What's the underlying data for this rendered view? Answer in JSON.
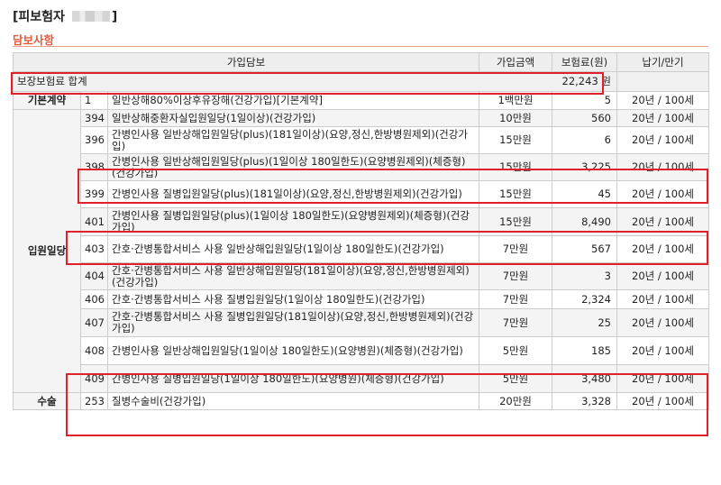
{
  "header": {
    "insured_label": "[피보험자",
    "insured_close": "]"
  },
  "section": {
    "title": "담보사항"
  },
  "columns": {
    "coverage": "가입담보",
    "amount": "가입금액",
    "premium": "보험료(원)",
    "term": "납기/만기"
  },
  "total": {
    "label": "보장보험료 합계",
    "value": "22,243 원"
  },
  "categories": {
    "basic": "기본계약",
    "hospital": "입원일당",
    "surgery": "수술"
  },
  "rows": [
    {
      "no": "1",
      "name": "일반상해80%이상후유장해(건강가입)[기본계약]",
      "amount": "1백만원",
      "premium": "5",
      "term": "20년 / 100세"
    },
    {
      "no": "394",
      "name": "일반상해중환자실입원일당(1일이상)(건강가입)",
      "amount": "10만원",
      "premium": "560",
      "term": "20년 / 100세"
    },
    {
      "no": "396",
      "name": "간병인사용 일반상해입원일당(plus)(181일이상)(요양,정신,한방병원제외)(건강가입)",
      "amount": "15만원",
      "premium": "6",
      "term": "20년 / 100세"
    },
    {
      "no": "398",
      "name": "간병인사용 일반상해입원일당(plus)(1일이상 180일한도)(요양병원제외)(체증형)(건강가입)",
      "amount": "15만원",
      "premium": "3,225",
      "term": "20년 / 100세"
    },
    {
      "no": "399",
      "name": "간병인사용 질병입원일당(plus)(181일이상)(요양,정신,한방병원제외)(건강가입)",
      "amount": "15만원",
      "premium": "45",
      "term": "20년 / 100세"
    },
    {
      "no": "401",
      "name": "간병인사용 질병입원일당(plus)(1일이상 180일한도)(요양병원제외)(체증형)(건강가입)",
      "amount": "15만원",
      "premium": "8,490",
      "term": "20년 / 100세"
    },
    {
      "no": "403",
      "name": "간호·간병통합서비스 사용 일반상해입원일당(1일이상 180일한도)(건강가입)",
      "amount": "7만원",
      "premium": "567",
      "term": "20년 / 100세"
    },
    {
      "no": "404",
      "name": "간호·간병통합서비스 사용 일반상해입원일당(181일이상)(요양,정신,한방병원제외)(건강가입)",
      "amount": "7만원",
      "premium": "3",
      "term": "20년 / 100세"
    },
    {
      "no": "406",
      "name": "간호·간병통합서비스 사용 질병입원일당(1일이상 180일한도)(건강가입)",
      "amount": "7만원",
      "premium": "2,324",
      "term": "20년 / 100세"
    },
    {
      "no": "407",
      "name": "간호·간병통합서비스 사용 질병입원일당(181일이상)(요양,정신,한방병원제외)(건강가입)",
      "amount": "7만원",
      "premium": "25",
      "term": "20년 / 100세"
    },
    {
      "no": "408",
      "name": "간병인사용 일반상해입원일당(1일이상 180일한도)(요양병원)(체증형)(건강가입)",
      "amount": "5만원",
      "premium": "185",
      "term": "20년 / 100세"
    },
    {
      "no": "409",
      "name": "간병인사용 질병입원일당(1일이상 180일한도)(요양병원)(체증형)(건강가입)",
      "amount": "5만원",
      "premium": "3,480",
      "term": "20년 / 100세"
    },
    {
      "no": "253",
      "name": "질병수술비(건강가입)",
      "amount": "20만원",
      "premium": "3,328",
      "term": "20년 / 100세"
    }
  ]
}
